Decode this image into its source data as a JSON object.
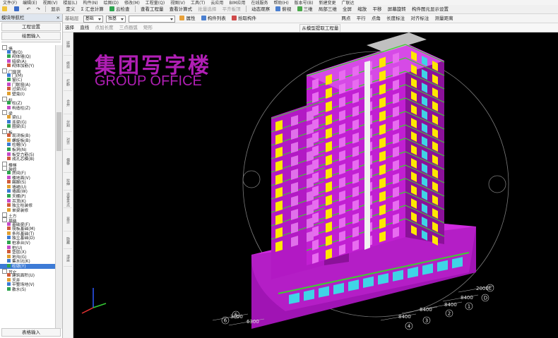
{
  "menu": [
    "文件(F)",
    "编辑(E)",
    "视图(V)",
    "楼层(L)",
    "构件(N)",
    "绘图(D)",
    "修改(M)",
    "工程量(Q)",
    "视图(V)",
    "工具(T)",
    "云应用",
    "BIM应用",
    "在线服务",
    "帮助(H)",
    "版本号(B)",
    "新建变更",
    "广联达"
  ],
  "toolbar1": {
    "buttons": [
      "显示",
      "定义",
      "Σ 汇总计算",
      "云检查",
      "查看工程量",
      "查看计算式",
      "批量选择",
      "平齐板顶"
    ],
    "buttons_right": [
      "动态观察",
      "俯视",
      "三维",
      "局部三维",
      "全屏",
      "缩放",
      "平移",
      "屏幕旋转",
      "构件图元显示设置"
    ]
  },
  "toolbar2": {
    "floor_label": "基础层",
    "floor_value": "基础",
    "component_value": "独基",
    "component2_value": "",
    "buttons": [
      "属性",
      "构件列表",
      "拾取构件"
    ],
    "buttons_right": [
      "两点",
      "平行",
      "点角",
      "长度标注",
      "对齐标注",
      "测量距离"
    ]
  },
  "toolbar3": {
    "buttons": [
      "选择",
      "直线",
      "点加长度",
      "三点画弧",
      "矩形"
    ],
    "buttons_right": [
      "从模型提取工程量"
    ]
  },
  "sidebar": {
    "title": "模块导航栏",
    "close": "×",
    "btn_settings": "工程设置",
    "btn_drawing": "绘图输入",
    "footer": "表格输入",
    "tree": [
      {
        "label": "墙",
        "level": 0
      },
      {
        "label": "墙(Q)",
        "level": 1
      },
      {
        "label": "砌体墙(Q)",
        "level": 1
      },
      {
        "label": "暗梁(A)",
        "level": 1
      },
      {
        "label": "砌体加筋(Y)",
        "level": 1
      },
      {
        "label": "门窗洞",
        "level": 0
      },
      {
        "label": "门(M)",
        "level": 1
      },
      {
        "label": "窗(C)",
        "level": 1
      },
      {
        "label": "门联窗(A)",
        "level": 1
      },
      {
        "label": "过梁(G)",
        "level": 1
      },
      {
        "label": "壁龛(I)",
        "level": 1
      },
      {
        "label": "柱",
        "level": 0
      },
      {
        "label": "柱(Z)",
        "level": 1
      },
      {
        "label": "构造柱(Z)",
        "level": 1
      },
      {
        "label": "梁",
        "level": 0
      },
      {
        "label": "梁(L)",
        "level": 1
      },
      {
        "label": "连梁(G)",
        "level": 1
      },
      {
        "label": "圈梁(E)",
        "level": 1
      },
      {
        "label": "板",
        "level": 0
      },
      {
        "label": "现浇板(B)",
        "level": 1
      },
      {
        "label": "螺旋板(B)",
        "level": 1
      },
      {
        "label": "柱帽(V)",
        "level": 1
      },
      {
        "label": "板洞(N)",
        "level": 1
      },
      {
        "label": "板受力筋(S)",
        "level": 1
      },
      {
        "label": "成孔芯模(B)",
        "level": 1
      },
      {
        "label": "楼梯",
        "level": 0
      },
      {
        "label": "装修",
        "level": 0
      },
      {
        "label": "房间(F)",
        "level": 1
      },
      {
        "label": "楼地面(V)",
        "level": 1
      },
      {
        "label": "踢脚(S)",
        "level": 1
      },
      {
        "label": "墙裙(U)",
        "level": 1
      },
      {
        "label": "墙面(W)",
        "level": 1
      },
      {
        "label": "天棚(P)",
        "level": 1
      },
      {
        "label": "吊顶(K)",
        "level": 1
      },
      {
        "label": "独立柱装修",
        "level": 1
      },
      {
        "label": "单梁装修",
        "level": 1
      },
      {
        "label": "土方",
        "level": 0
      },
      {
        "label": "基础",
        "level": 0
      },
      {
        "label": "基础梁(F)",
        "level": 1
      },
      {
        "label": "筏板基础(M)",
        "level": 1
      },
      {
        "label": "条形基础(T)",
        "level": 1
      },
      {
        "label": "独立基础(D)",
        "level": 1
      },
      {
        "label": "桩承台(V)",
        "level": 1
      },
      {
        "label": "桩(U)",
        "level": 1
      },
      {
        "label": "垫层(X)",
        "level": 1
      },
      {
        "label": "地沟(G)",
        "level": 1
      },
      {
        "label": "集水坑(K)",
        "level": 1
      },
      {
        "label": "柱墩(Y)",
        "level": 1,
        "selected": true
      },
      {
        "label": "其它",
        "level": 0
      },
      {
        "label": "建筑面积(U)",
        "level": 1
      },
      {
        "label": "天井",
        "level": 1
      },
      {
        "label": "平整场地(V)",
        "level": 1
      },
      {
        "label": "散水(S)",
        "level": 1
      }
    ]
  },
  "vtools": [
    "延伸",
    "修剪",
    "打断",
    "合并",
    "分割",
    "对齐",
    "偏移",
    "拉伸",
    "设置夹点",
    "显示",
    "隐藏",
    "渲染"
  ],
  "brand": {
    "title_cn": "集团写字楼",
    "title_en": "GROUP OFFICE"
  },
  "dimensions": [
    "2000",
    "8400",
    "8400",
    "8400",
    "8400",
    "3000",
    "6300"
  ],
  "axis_labels": [
    "E",
    "D",
    "1",
    "2",
    "3",
    "4",
    "5",
    "6"
  ],
  "colors": {
    "bg": "#000000",
    "building_main": "#c11fd2",
    "building_dark": "#8b1199",
    "green_edge": "#3ecf2f",
    "window_yellow": "#ffe800",
    "window_cyan": "#3fd4e6",
    "brand_text": "#b01fb4"
  }
}
